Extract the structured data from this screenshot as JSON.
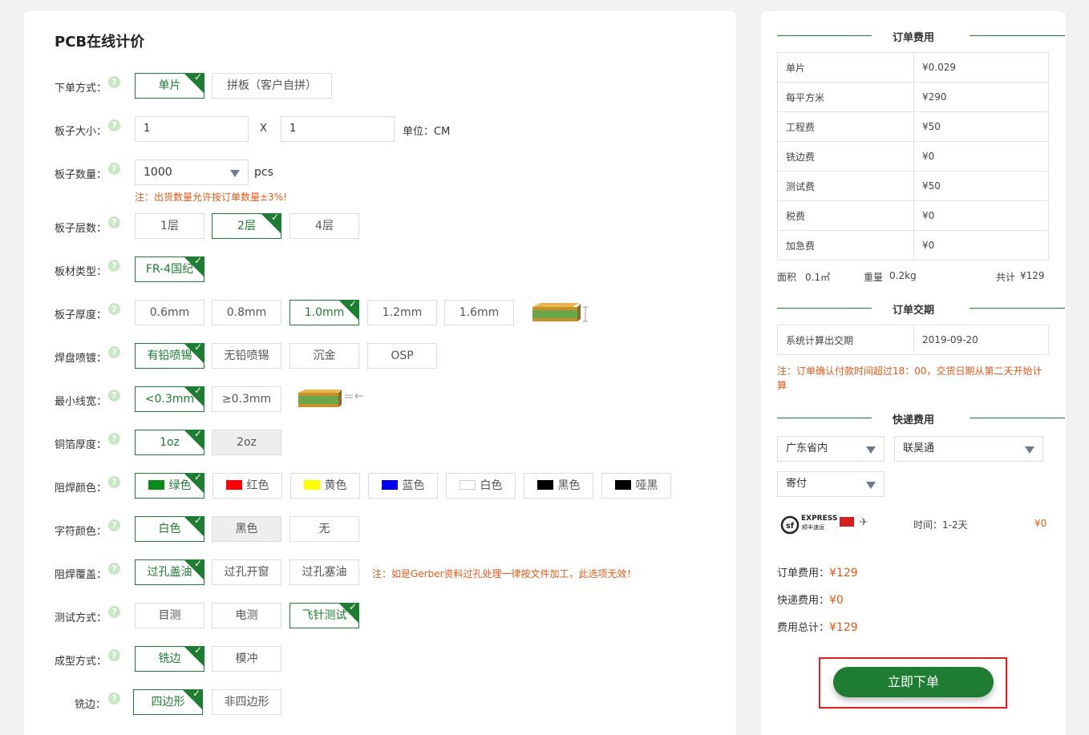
{
  "page_title": "PCB在线计价",
  "help_glyph": "?",
  "check_glyph": "✓",
  "order_method": {
    "label": "下单方式：",
    "options": [
      "单片",
      "拼板（客户自拼）"
    ],
    "selected": 0
  },
  "board_size": {
    "label": "板子大小：",
    "width": "1",
    "height": "1",
    "times": "X",
    "unit": "单位：CM"
  },
  "board_qty": {
    "label": "板子数量：",
    "value": "1000",
    "unit": "pcs",
    "note": "注：出货数量允许按订单数量±3%!"
  },
  "layers": {
    "label": "板子层数：",
    "options": [
      "1层",
      "2层",
      "4层"
    ],
    "selected": 1
  },
  "material": {
    "label": "板材类型：",
    "options": [
      "FR-4国纪"
    ],
    "selected": 0
  },
  "thickness": {
    "label": "板子厚度：",
    "options": [
      "0.6mm",
      "0.8mm",
      "1.0mm",
      "1.2mm",
      "1.6mm"
    ],
    "selected": 2
  },
  "surface": {
    "label": "焊盘喷镀：",
    "options": [
      "有铅喷锡",
      "无铅喷锡",
      "沉金",
      "OSP"
    ],
    "selected": 0
  },
  "min_trace": {
    "label": "最小线宽：",
    "options": [
      "<0.3mm",
      "≥0.3mm"
    ],
    "selected": 0
  },
  "copper": {
    "label": "铜箔厚度：",
    "options": [
      "1oz",
      "2oz"
    ],
    "selected": 0
  },
  "solder_color": {
    "label": "阻焊颜色：",
    "options": [
      {
        "text": "绿色",
        "color": "#0a8a1a"
      },
      {
        "text": "红色",
        "color": "#ff0000"
      },
      {
        "text": "黄色",
        "color": "#ffff00"
      },
      {
        "text": "蓝色",
        "color": "#0000ee"
      },
      {
        "text": "白色",
        "color": "#ffffff"
      },
      {
        "text": "黑色",
        "color": "#000000"
      },
      {
        "text": "哑黑",
        "color": "#000000"
      }
    ],
    "selected": 0
  },
  "silk_color": {
    "label": "字符颜色：",
    "options": [
      "白色",
      "黑色",
      "无"
    ],
    "selected": 0
  },
  "via_cover": {
    "label": "阻焊覆盖：",
    "options": [
      "过孔盖油",
      "过孔开窗",
      "过孔塞油"
    ],
    "selected": 0,
    "note": "注：如是Gerber资料过孔处理一律按文件加工，此选项无效！"
  },
  "test_method": {
    "label": "测试方式：",
    "options": [
      "目测",
      "电测",
      "飞针测试"
    ],
    "selected": 2
  },
  "forming": {
    "label": "成型方式：",
    "options": [
      "铣边",
      "模冲"
    ],
    "selected": 0
  },
  "milling": {
    "label": "铣边：",
    "options": [
      "四边形",
      "非四边形"
    ],
    "selected": 0
  },
  "order_fee": {
    "title": "订单费用",
    "rows": [
      [
        "单片",
        "¥0.029"
      ],
      [
        "每平方米",
        "¥290"
      ],
      [
        "工程费",
        "¥50"
      ],
      [
        "铣边费",
        "¥0"
      ],
      [
        "测试费",
        "¥50"
      ],
      [
        "税费",
        "¥0"
      ],
      [
        "加急费",
        "¥0"
      ]
    ],
    "area_label": "面积",
    "area": "0.1㎡",
    "weight_label": "重量",
    "weight": "0.2kg",
    "total_label": "共计",
    "total": "¥129"
  },
  "delivery": {
    "title": "订单交期",
    "label": "系统计算出交期",
    "date": "2019-09-20",
    "note": "注：订单确认付款时间超过18：00，交货日期从第二天开始计算"
  },
  "shipping": {
    "title": "快递费用",
    "region": "广东省内",
    "carrier": "联昊通",
    "payment": "寄付",
    "logo_text": "EXPRESS",
    "logo_sub": "顺丰速运",
    "time": "时间：1-2天",
    "price": "¥0"
  },
  "summary": {
    "order_label": "订单费用：",
    "order_value": "¥129",
    "ship_label": "快递费用：",
    "ship_value": "¥0",
    "total_label": "费用总计：",
    "total_value": "¥129"
  },
  "submit_label": "立即下单"
}
